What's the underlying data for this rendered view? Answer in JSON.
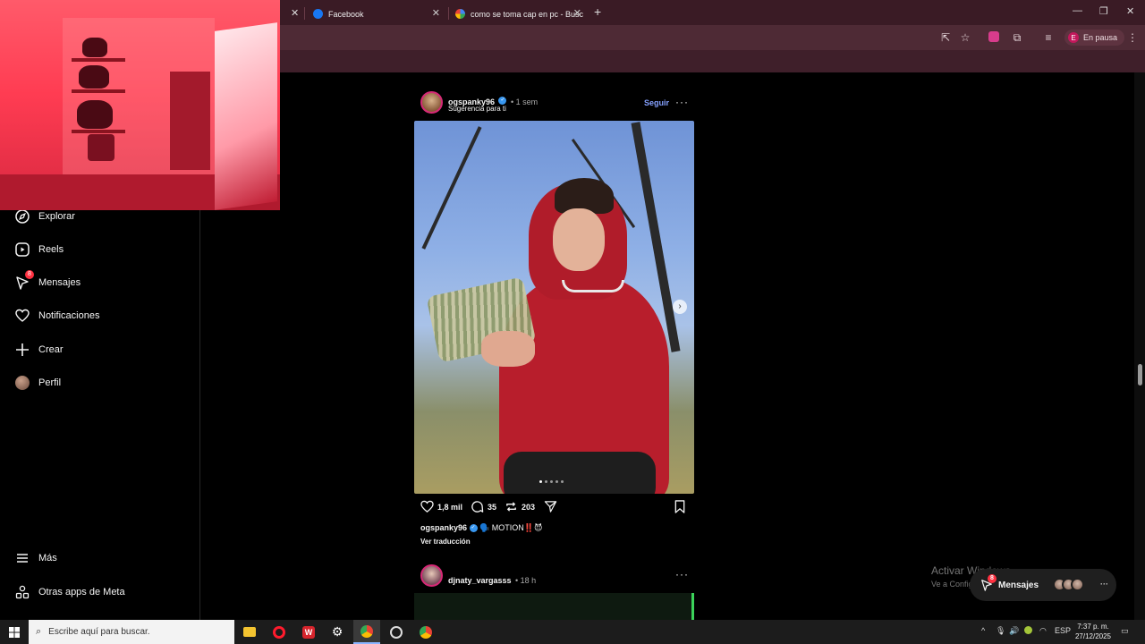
{
  "browser": {
    "tabs": [
      {
        "label": "Facebook",
        "active": false
      },
      {
        "label": "como se toma cap en pc - Busc",
        "active": false
      }
    ],
    "profile_status": "En pausa",
    "profile_initial": "E"
  },
  "sidebar": {
    "items": [
      {
        "label": "Explorar",
        "icon": "compass-icon"
      },
      {
        "label": "Reels",
        "icon": "reels-icon"
      },
      {
        "label": "Mensajes",
        "icon": "messenger-icon",
        "badge": "8"
      },
      {
        "label": "Notificaciones",
        "icon": "heart-icon"
      },
      {
        "label": "Crear",
        "icon": "plus-icon"
      },
      {
        "label": "Perfil",
        "icon": "avatar"
      }
    ],
    "bottom": [
      {
        "label": "Más",
        "icon": "menu-icon"
      },
      {
        "label": "Otras apps de Meta",
        "icon": "meta-apps-icon"
      }
    ]
  },
  "post": {
    "username": "ogspanky96",
    "time": "1 sem",
    "subtitle": "Sugerencia para ti",
    "follow_label": "Seguir",
    "likes": "1,8 mil",
    "comments": "35",
    "reposts": "203",
    "caption_user": "ogspanky96",
    "caption_text": "🗣️ MOTION‼️😈",
    "translate_label": "Ver traducción",
    "carousel_count": 5,
    "carousel_active": 1
  },
  "post2": {
    "username": "djnaty_vargasss",
    "time": "18 h"
  },
  "messages_bar": {
    "label": "Mensajes",
    "badge": "8"
  },
  "watermark": {
    "title": "Activar Windows",
    "subtitle": "Ve a Configuración para activar Windows."
  },
  "taskbar": {
    "search_placeholder": "Escribe aquí para buscar.",
    "language": "ESP",
    "time": "7:37 p. m.",
    "date": "27/12/2025"
  },
  "colors": {
    "tab_bar": "#3a1b25",
    "toolbar": "#4e2a35",
    "follow": "#85a1ff",
    "badge": "#ff3040"
  }
}
